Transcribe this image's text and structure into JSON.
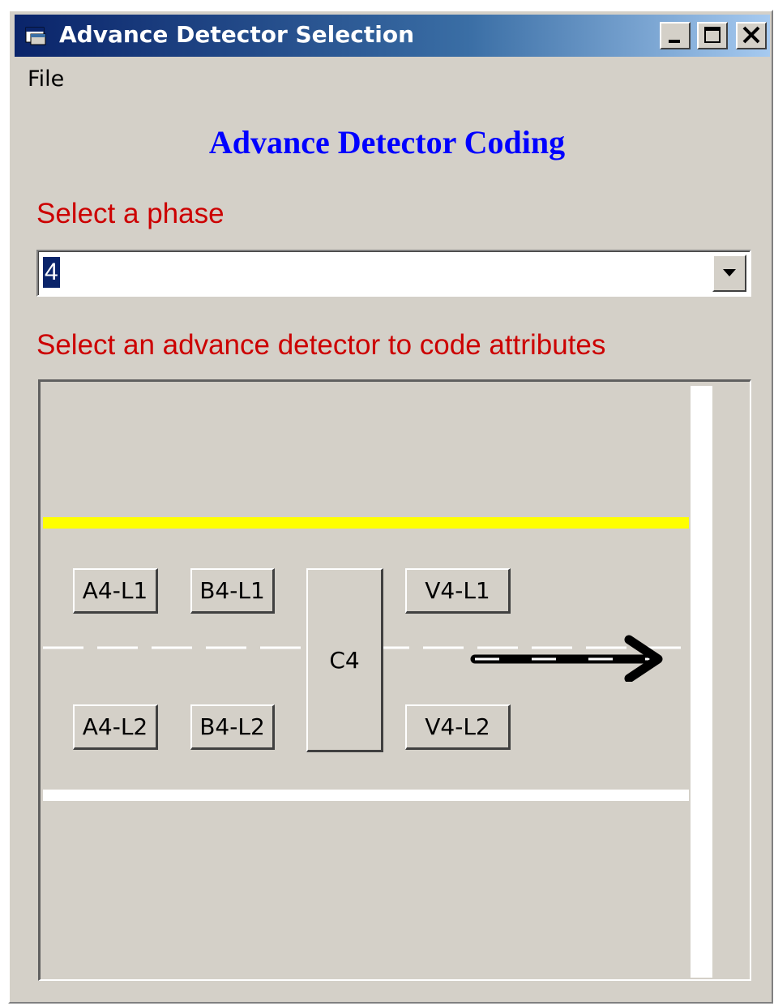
{
  "window": {
    "title": "Advance Detector Selection",
    "icon": "app-window-icon",
    "controls": {
      "minimize": "minimize-icon",
      "maximize": "maximize-icon",
      "close": "close-icon"
    }
  },
  "menu": {
    "items": [
      "File"
    ]
  },
  "heading": "Advance Detector Coding",
  "phase": {
    "label": "Select a phase",
    "selected": "4",
    "dropdown_icon": "chevron-down-icon"
  },
  "detector": {
    "label": "Select an advance detector to code attributes",
    "buttons": {
      "a4_l1": "A4-L1",
      "b4_l1": "B4-L1",
      "c4": "C4",
      "v4_l1": "V4-L1",
      "a4_l2": "A4-L2",
      "b4_l2": "B4-L2",
      "v4_l2": "V4-L2"
    },
    "direction_icon": "right-arrow-icon"
  },
  "colors": {
    "heading": "#0000ff",
    "labels": "#cc0000",
    "title_bar_start": "#0a246a",
    "title_bar_end": "#a6caf0",
    "yellow_line": "#ffff00",
    "face": "#d4d0c8"
  }
}
